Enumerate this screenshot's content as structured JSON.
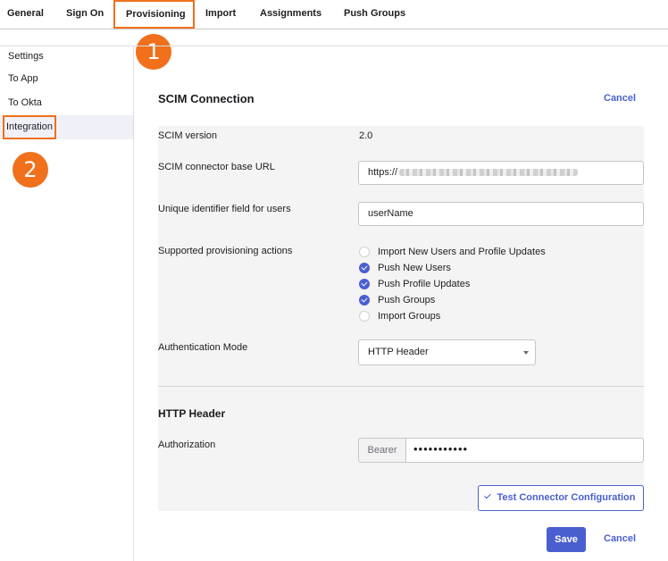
{
  "tabs": [
    "General",
    "Sign On",
    "Provisioning",
    "Import",
    "Assignments",
    "Push Groups"
  ],
  "callouts": [
    "1",
    "2"
  ],
  "sidebar": {
    "title": "Settings",
    "items": [
      "To App",
      "To Okta",
      "Integration"
    ]
  },
  "scim": {
    "heading": "SCIM Connection",
    "cancel_label": "Cancel",
    "version_label": "SCIM version",
    "version_value": "2.0",
    "base_url_label": "SCIM connector base URL",
    "base_url_value": "https://",
    "unique_id_label": "Unique identifier field for users",
    "unique_id_value": "userName",
    "actions_label": "Supported provisioning actions",
    "actions": [
      {
        "label": "Import New Users and Profile Updates",
        "checked": false
      },
      {
        "label": "Push New Users",
        "checked": true
      },
      {
        "label": "Push Profile Updates",
        "checked": true
      },
      {
        "label": "Push Groups",
        "checked": true
      },
      {
        "label": "Import Groups",
        "checked": false
      }
    ],
    "auth_mode_label": "Authentication Mode",
    "auth_mode_value": "HTTP Header"
  },
  "http_header": {
    "heading": "HTTP Header",
    "authorization_label": "Authorization",
    "prefix": "Bearer",
    "token_masked": "•••••••••••",
    "test_button_label": "Test Connector Configuration"
  },
  "footer": {
    "save_label": "Save",
    "cancel_label": "Cancel"
  },
  "colors": {
    "accent": "#4a5fcf",
    "highlight": "#f0701c"
  }
}
